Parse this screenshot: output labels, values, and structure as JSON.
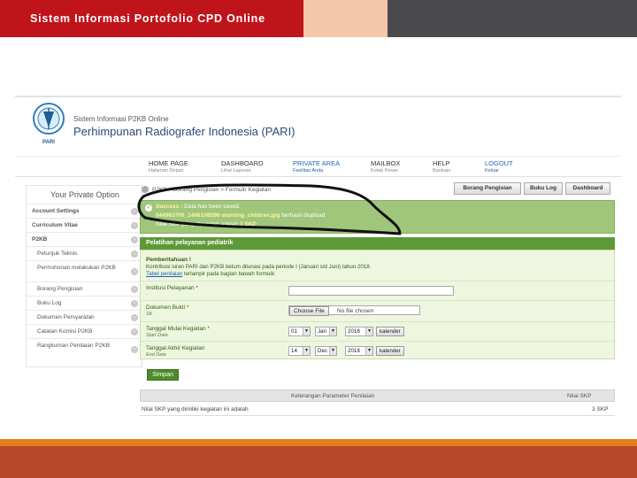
{
  "slide": {
    "title": "Sistem Informasi Portofolio CPD Online"
  },
  "site": {
    "system_name": "Sistem Informasi P2KB Online",
    "org_name": "Perhimpunan Radiografer Indonesia (PARI)",
    "logo_text": "PARI"
  },
  "nav": [
    {
      "label": "HOME PAGE",
      "sub": "Halaman Depan"
    },
    {
      "label": "DASHBOARD",
      "sub": "Lihat Laporan"
    },
    {
      "label": "PRIVATE AREA",
      "sub": "Fasilitas Anda"
    },
    {
      "label": "MAILBOX",
      "sub": "Kotak Pesan"
    },
    {
      "label": "HELP",
      "sub": "Bantuan"
    },
    {
      "label": "LOGOUT",
      "sub": "Keluar"
    }
  ],
  "sidebar": {
    "title": "Your Private Option",
    "items": [
      "Account Settings",
      "Curriculum Vitae",
      "P2KB",
      "Petunjuk Teknis",
      "Permohonan melakukan P2KB",
      "Borang Pengisian",
      "Buku Log",
      "Dokumen Persyaratan",
      "Catatan Komisi P2KB",
      "Rangkuman Penilaian P2KB"
    ]
  },
  "breadcrumb": "P2KB > Borang Pengisian > Formulir Kegiatan",
  "top_buttons": [
    "Borang Pengisian",
    "Buku Log",
    "Dashboard"
  ],
  "success": {
    "label": "Success :",
    "message": "Data has been saved.",
    "filename": "044963700_1446108596-stunting_children.jpg",
    "uploaded": "berhasil diupload",
    "skp_text": "Nilai SKP yang diperoleh adalah",
    "skp_value": "3 SKP"
  },
  "form": {
    "header": "Pelatihan pelayanan pediatrik",
    "notice_title": "Pemberitahuan !",
    "notice_line1": "Kontribusi iuran PARI dan P2KB belum dilunasi pada periode I (Januari s/d Juni) tahun 2018.",
    "notice_link": "Tabel penilaian",
    "notice_line2": "terlampir pada bagian bawah formulir.",
    "institusi_label": "Institusi Pelayanan *",
    "institusi_sub": "-",
    "dokumen_label": "Dokumen Bukti *",
    "dokumen_sub": "SK",
    "choose_file": "Choose File",
    "no_file": "No file chosen",
    "mulai_label": "Tanggal Mulai Kegiatan *",
    "mulai_sub": "Start Date",
    "mulai_day": "01",
    "mulai_month": "Jan",
    "mulai_year": "2018",
    "akhir_label": "Tanggal Akhir Kegiatan",
    "akhir_sub": "End Date",
    "akhir_day": "14",
    "akhir_month": "Dec",
    "akhir_year": "2018",
    "kalender": "kalender",
    "submit": "Simpan"
  },
  "table": {
    "headers": [
      "Keterangan Parameter Penilaian",
      "Nilai SKP"
    ],
    "rows": [
      [
        "Nilai SKP yang dimiliki kegiatan ini adalah",
        "3 SKP"
      ]
    ]
  },
  "colors": {
    "header_red": "#c0141b",
    "header_peach": "#f5c7a9",
    "header_gray": "#4a4a4c",
    "footer_orange": "#e07f1c",
    "footer_rust": "#b7472a",
    "form_green": "#5d9a37",
    "success_green": "#9fc67a"
  }
}
